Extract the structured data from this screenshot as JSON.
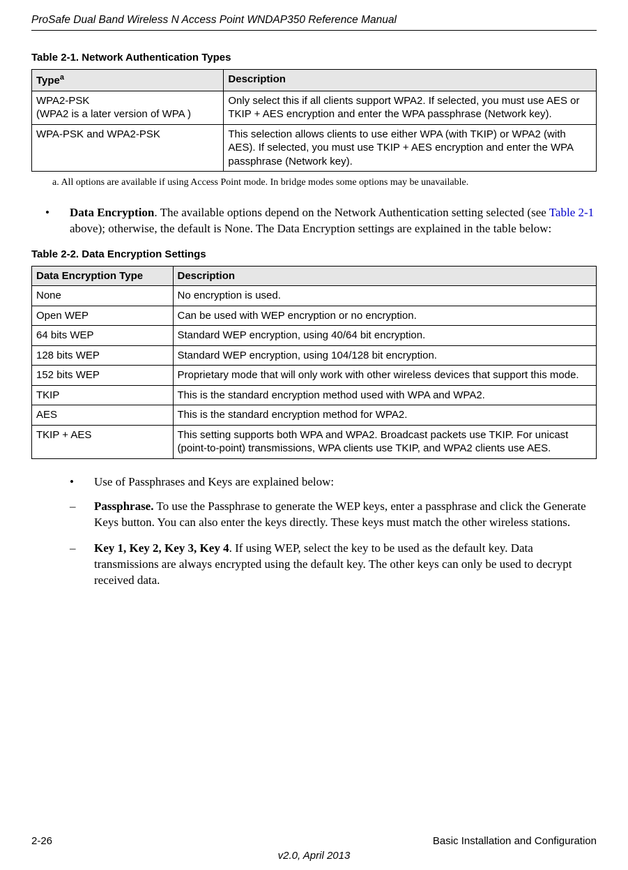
{
  "header_title": "ProSafe Dual Band Wireless N Access Point WNDAP350 Reference Manual",
  "table1": {
    "caption": "Table 2-1. Network Authentication Types",
    "headers": [
      "Type",
      "Description"
    ],
    "rows": [
      {
        "c0a": "WPA2-PSK",
        "c0b": "(WPA2 is a later version of WPA )",
        "c1": "Only select this if all clients support WPA2. If selected, you must use AES or TKIP + AES encryption and enter the WPA passphrase (Network key)."
      },
      {
        "c0": "WPA-PSK and WPA2-PSK",
        "c1": "This selection allows clients to use either WPA (with TKIP) or WPA2 (with AES). If selected, you must use TKIP + AES encryption and enter the WPA passphrase (Network key)."
      }
    ],
    "footnote": "a. All options are available if using Access Point mode. In bridge modes some options may be unavailable."
  },
  "body_item1": {
    "bold": "Data Encryption",
    "text1": ". The available options depend on the Network Authentication setting selected (see ",
    "link": "Table 2-1",
    "text2": " above); otherwise, the default is None. The Data Encryption settings are explained in the table below:"
  },
  "table2": {
    "caption": "Table 2-2. Data Encryption Settings",
    "headers": [
      "Data Encryption Type",
      "Description"
    ],
    "rows": [
      {
        "c0": "None",
        "c1": "No encryption is used."
      },
      {
        "c0": "Open WEP",
        "c1": "Can be used with WEP encryption or no encryption."
      },
      {
        "c0": "64 bits WEP",
        "c1": "Standard WEP encryption, using 40/64 bit encryption."
      },
      {
        "c0": "128 bits WEP",
        "c1": "Standard WEP encryption, using 104/128 bit encryption."
      },
      {
        "c0": "152 bits WEP",
        "c1": "Proprietary mode that will only work with other wireless devices that support this mode."
      },
      {
        "c0": "TKIP",
        "c1": "This is the standard encryption method used with WPA and WPA2."
      },
      {
        "c0": "AES",
        "c1": "This is the standard encryption method for WPA2."
      },
      {
        "c0": "TKIP + AES",
        "c1": "This setting supports both WPA and WPA2. Broadcast packets use TKIP. For unicast (point-to-point) transmissions, WPA clients use TKIP, and WPA2 clients use AES."
      }
    ]
  },
  "body_item2": "Use of Passphrases and Keys are explained below:",
  "sub1": {
    "bold": "Passphrase.",
    "rest": " To use the Passphrase to generate the WEP keys, enter a passphrase and click the Generate Keys button. You can also enter the keys directly. These keys must match the other wireless stations."
  },
  "sub2": {
    "bold": "Key 1, Key 2, Key 3, Key 4",
    "rest": ". If using WEP, select the key to be used as the default key. Data transmissions are always encrypted using the default key. The other keys can only be used to decrypt received data."
  },
  "footer": {
    "left": "2-26",
    "right": "Basic Installation and Configuration",
    "center": "v2.0, April 2013"
  }
}
